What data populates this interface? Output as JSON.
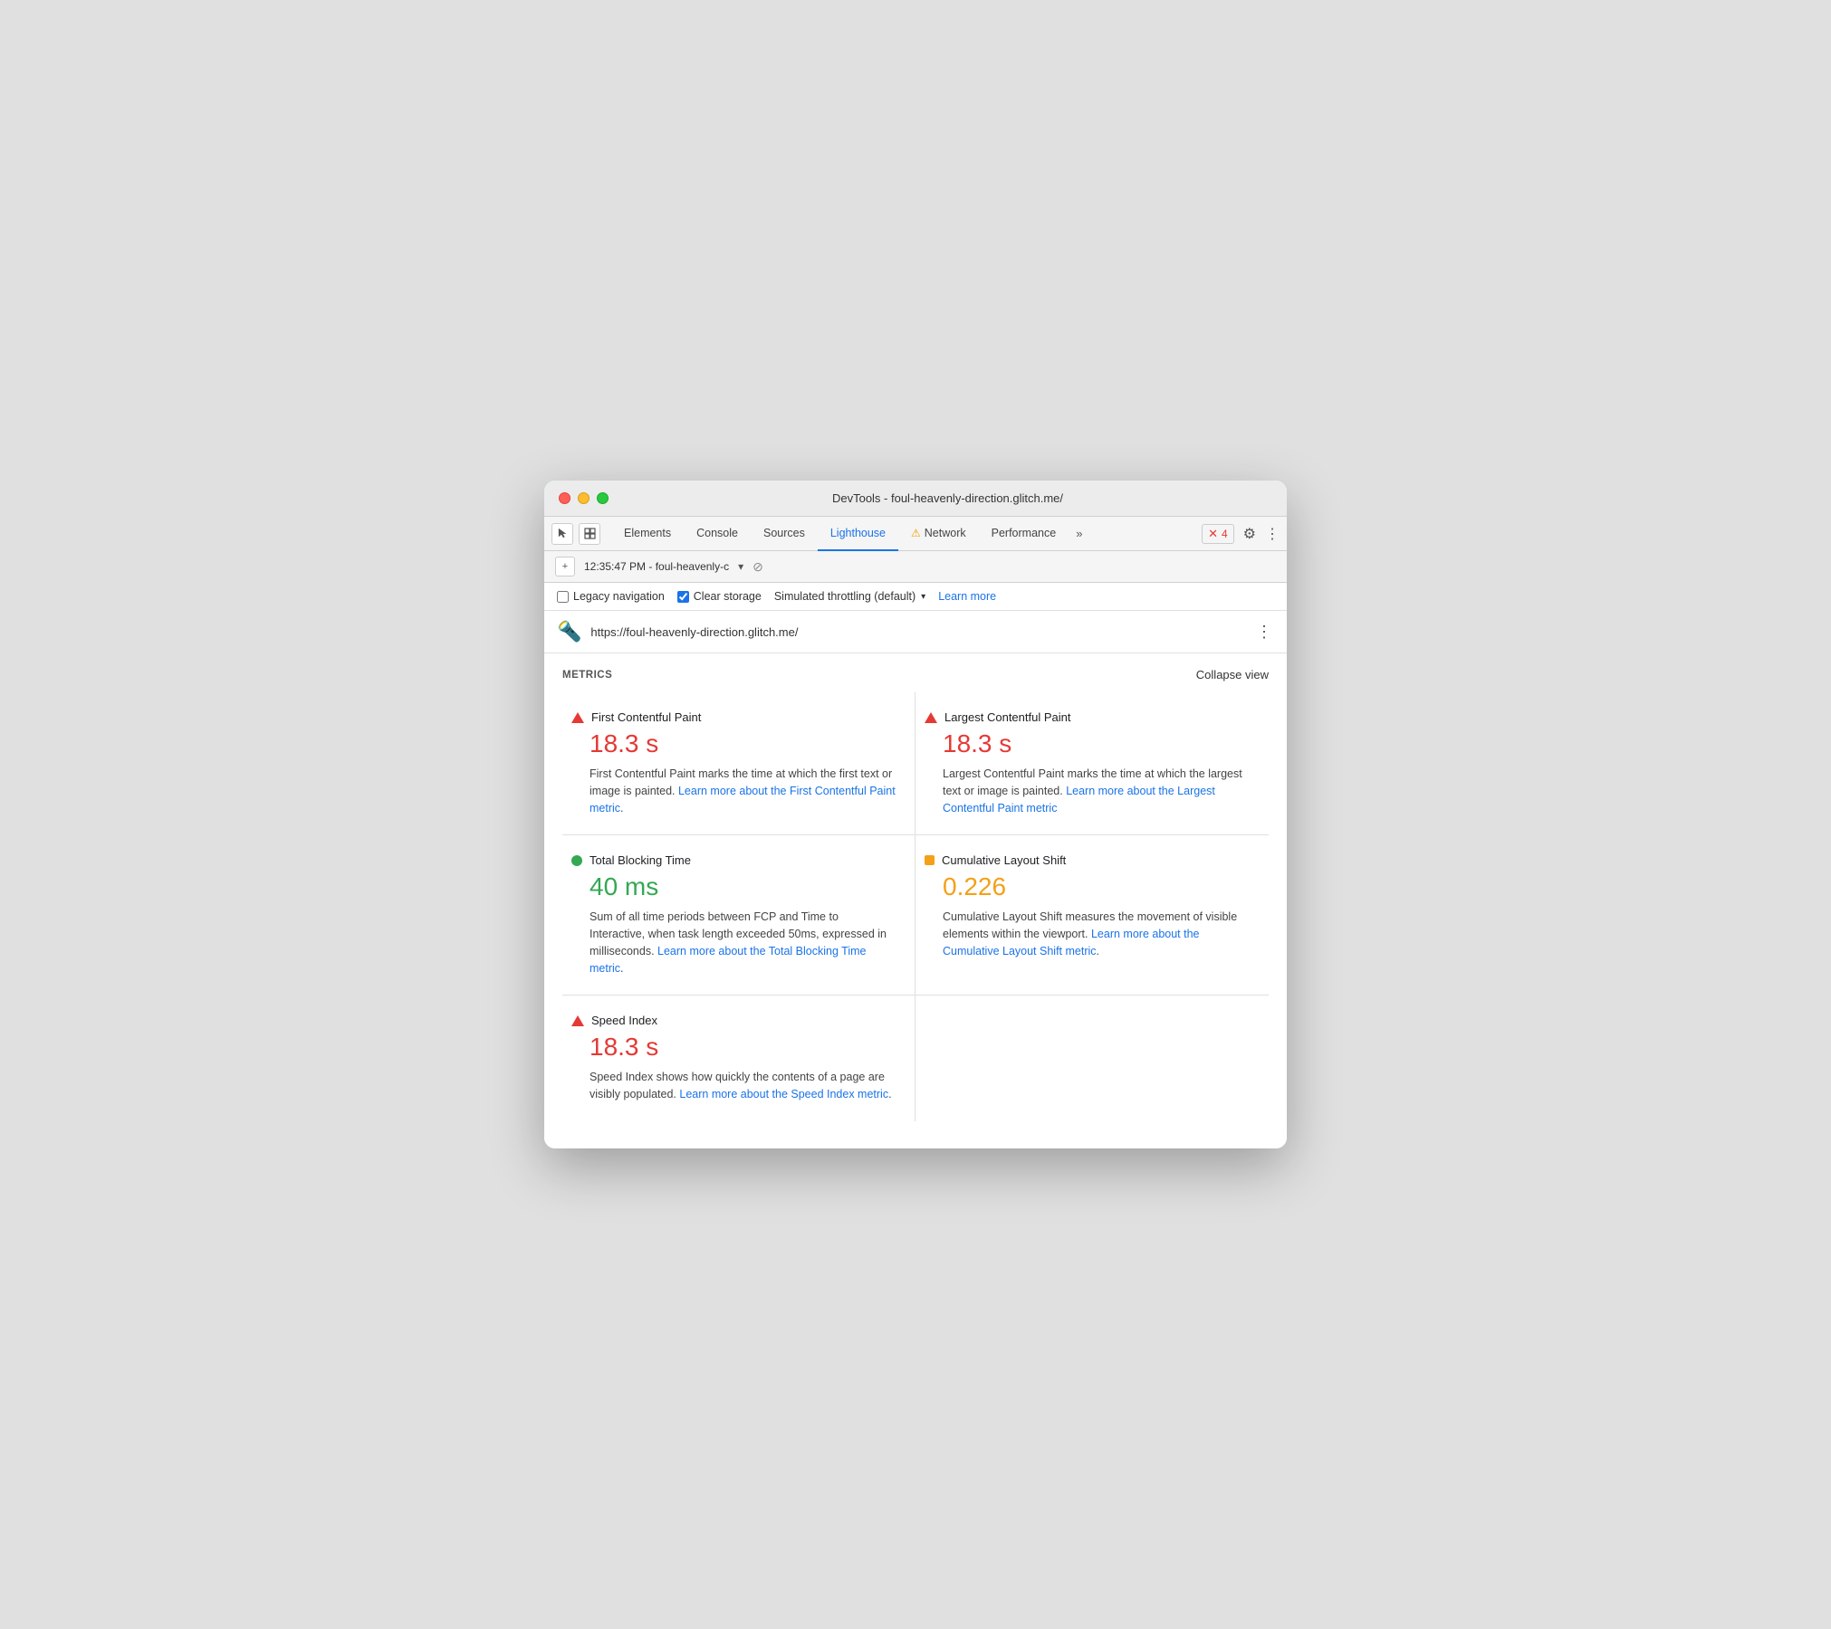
{
  "window": {
    "title": "DevTools - foul-heavenly-direction.glitch.me/"
  },
  "traffic_lights": {
    "red_label": "close",
    "yellow_label": "minimize",
    "green_label": "maximize"
  },
  "tabs": {
    "items": [
      {
        "label": "Elements",
        "active": false
      },
      {
        "label": "Console",
        "active": false
      },
      {
        "label": "Sources",
        "active": false
      },
      {
        "label": "Lighthouse",
        "active": true
      },
      {
        "label": "Network",
        "active": false,
        "warn": true
      },
      {
        "label": "Performance",
        "active": false
      },
      {
        "label": "»",
        "active": false,
        "more": true
      }
    ],
    "error_count": "4",
    "gear_label": "⚙",
    "more_label": "⋮"
  },
  "toolbar": {
    "add_label": "+",
    "timestamp": "12:35:47 PM - foul-heavenly-c",
    "dropdown_arrow": "▾",
    "block_icon": "⊘"
  },
  "options": {
    "legacy_navigation_label": "Legacy navigation",
    "legacy_navigation_checked": false,
    "clear_storage_label": "Clear storage",
    "clear_storage_checked": true,
    "throttling_label": "Simulated throttling (default)",
    "throttling_arrow": "▾",
    "learn_more_label": "Learn more"
  },
  "url_bar": {
    "icon": "🔦",
    "url": "https://foul-heavenly-direction.glitch.me/",
    "more_icon": "⋮"
  },
  "metrics": {
    "section_title": "METRICS",
    "collapse_label": "Collapse view",
    "items": [
      {
        "id": "fcp",
        "indicator": "red-triangle",
        "name": "First Contentful Paint",
        "value": "18.3 s",
        "value_color": "red",
        "desc_before": "First Contentful Paint marks the time at which the first text or image is painted.",
        "link_text": "Learn more about the First Contentful Paint metric",
        "desc_after": "."
      },
      {
        "id": "lcp",
        "indicator": "red-triangle",
        "name": "Largest Contentful Paint",
        "value": "18.3 s",
        "value_color": "red",
        "desc_before": "Largest Contentful Paint marks the time at which the largest text or image is painted.",
        "link_text": "Learn more about the Largest Contentful Paint metric",
        "desc_after": ""
      },
      {
        "id": "tbt",
        "indicator": "green-circle",
        "name": "Total Blocking Time",
        "value": "40 ms",
        "value_color": "green",
        "desc_before": "Sum of all time periods between FCP and Time to Interactive, when task length exceeded 50ms, expressed in milliseconds.",
        "link_text": "Learn more about the Total Blocking Time metric",
        "desc_after": "."
      },
      {
        "id": "cls",
        "indicator": "orange-square",
        "name": "Cumulative Layout Shift",
        "value": "0.226",
        "value_color": "orange",
        "desc_before": "Cumulative Layout Shift measures the movement of visible elements within the viewport.",
        "link_text": "Learn more about the Cumulative Layout Shift metric",
        "desc_after": "."
      },
      {
        "id": "si",
        "indicator": "red-triangle",
        "name": "Speed Index",
        "value": "18.3 s",
        "value_color": "red",
        "desc_before": "Speed Index shows how quickly the contents of a page are visibly populated.",
        "link_text": "Learn more about the Speed Index metric",
        "desc_after": ".",
        "no_border": true,
        "right_empty": true
      }
    ]
  }
}
